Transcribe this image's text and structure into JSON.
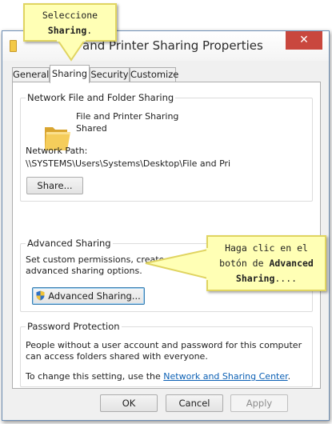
{
  "window": {
    "title": "and Printer Sharing Properties",
    "close_glyph": "✕"
  },
  "tabs": [
    {
      "label": "General"
    },
    {
      "label": "Sharing",
      "active": true
    },
    {
      "label": "Security"
    },
    {
      "label": "Customize"
    }
  ],
  "network_sharing": {
    "group_label": "Network File and Folder Sharing",
    "folder_icon": "folder-icon",
    "item_name": "File and Printer Sharing",
    "item_status": "Shared",
    "path_label": "Network Path:",
    "path_value": "\\\\SYSTEMS\\Users\\Systems\\Desktop\\File and Pri",
    "share_button": "Share..."
  },
  "advanced_sharing": {
    "group_label": "Advanced Sharing",
    "description_line1": "Set custom permissions, create multiple shares, and set other",
    "description_line2": "advanced sharing options.",
    "button_label": "Advanced Sharing...",
    "button_icon": "uac-shield-icon"
  },
  "password_protection": {
    "group_label": "Password Protection",
    "description_line1": "People without a user account and password for this computer",
    "description_line2": "can access folders shared with everyone.",
    "change_prefix": "To change this setting, use the ",
    "change_link": "Network and Sharing Center",
    "change_suffix": "."
  },
  "footer": {
    "ok": "OK",
    "cancel": "Cancel",
    "apply": "Apply"
  },
  "callouts": {
    "top": {
      "line1": "Seleccione",
      "bold": "Sharing",
      "suffix": "."
    },
    "right": {
      "line1": "Haga clic en el",
      "line2_prefix": "botón de ",
      "line2_bold": "Advanced",
      "line3_bold": "Sharing",
      "line3_suffix": "...."
    }
  },
  "colors": {
    "callout_bg": "#ffffb5",
    "link": "#0a5fb4",
    "close": "#c9473e"
  }
}
